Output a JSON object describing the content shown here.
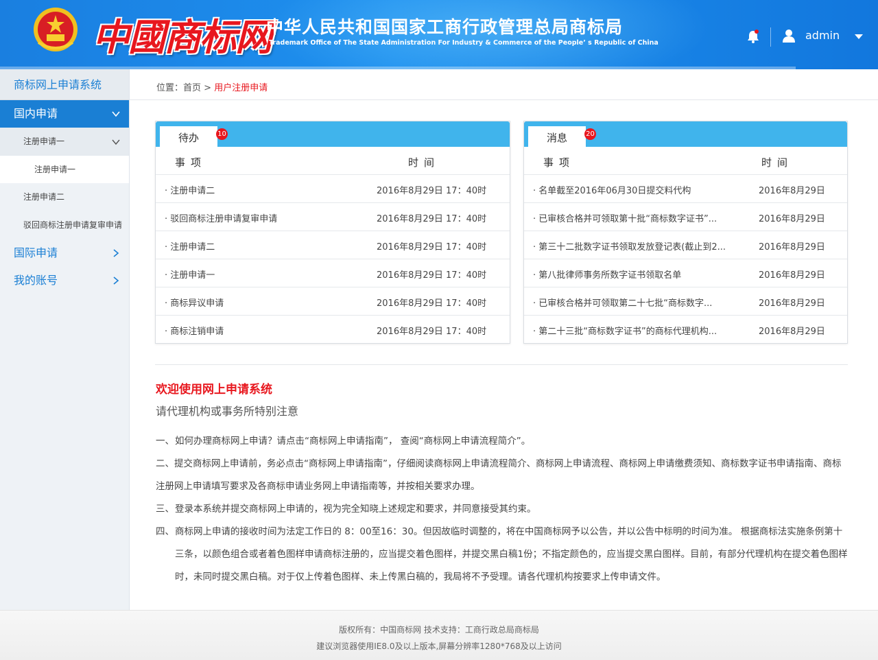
{
  "header": {
    "logo_text": "中國商标网",
    "org_title": "中华人民共和国国家工商行政管理总局商标局",
    "org_subtitle": "Trademark Office of The State Administration For Industry & Commerce of the People’ s Republic of China",
    "username": "admin"
  },
  "sidebar": {
    "title": "商标网上申请系统",
    "domestic": "国内申请",
    "reg1": "注册申请一",
    "reg1_sub": "注册申请一",
    "reg2": "注册申请二",
    "reject_review": "驳回商标注册申请复审申请",
    "intl": "国际申请",
    "account": "我的账号"
  },
  "breadcrumb": {
    "label": "位置：",
    "home": "首页",
    "sep": ">",
    "current": "用户注册申请"
  },
  "todo": {
    "tab": "待办",
    "badge": "10",
    "col_item": "事项",
    "col_time": "时间",
    "rows": [
      {
        "title": "· 注册申请二",
        "time": "2016年8月29日  17：40时"
      },
      {
        "title": "· 驳回商标注册申请复审申请",
        "time": "2016年8月29日  17：40时"
      },
      {
        "title": "· 注册申请二",
        "time": "2016年8月29日  17：40时"
      },
      {
        "title": "· 注册申请一",
        "time": "2016年8月29日  17：40时"
      },
      {
        "title": "· 商标异议申请",
        "time": "2016年8月29日  17：40时"
      },
      {
        "title": "· 商标注销申请",
        "time": "2016年8月29日  17：40时"
      }
    ]
  },
  "messages": {
    "tab": "消息",
    "badge": "20",
    "col_item": "事项",
    "col_time": "时间",
    "rows": [
      {
        "title": "· 名单截至2016年06月30日提交料代构",
        "time": "2016年8月29日"
      },
      {
        "title": "· 已审核合格并可领取第十批“商标数字证书”...",
        "time": "2016年8月29日"
      },
      {
        "title": "· 第三十二批数字证书领取发放登记表(截止到2...",
        "time": "2016年8月29日"
      },
      {
        "title": "· 第八批律师事务所数字证书领取名单",
        "time": "2016年8月29日"
      },
      {
        "title": "· 已审核合格并可领取第二十七批“商标数字...",
        "time": "2016年8月29日"
      },
      {
        "title": "· 第二十三批“商标数字证书”的商标代理机构...",
        "time": "2016年8月29日"
      }
    ]
  },
  "welcome": {
    "title": "欢迎使用网上申请系统",
    "subtitle": "请代理机构或事务所特别注意",
    "rules": [
      {
        "num": "一、",
        "text": "如何办理商标网上申请？请点击“商标网上申请指南”， 查阅“商标网上申请流程简介”。"
      },
      {
        "num": "二、",
        "text": "提交商标网上申请前，务必点击“商标网上申请指南”，仔细阅读商标网上申请流程简介、商标网上申请流程、商标网上申请缴费须知、商标数字证书申请指南、商标注册网上申请填写要求及各商标申请业务网上申请指南等，并按相关要求办理。"
      },
      {
        "num": "三、",
        "text": "登录本系统并提交商标网上申请的，视为完全知晓上述规定和要求，并同意接受其约束。"
      },
      {
        "num": "四、",
        "text": "商标网上申请的接收时间为法定工作日的 8：00至16：30。但因故临时调整的，将在中国商标网予以公告，并以公告中标明的时间为准。 根据商标法实施条例第十三条，以颜色组合或者着色图样申请商标注册的，应当提交着色图样，并提交黑白稿1份；不指定颜色的，应当提交黑白图样。目前，有部分代理机构在提交着色图样时，未同时提交黑白稿。对于仅上传着色图样、未上传黑白稿的，我局将不予受理。请各代理机构按要求上传申请文件。"
      }
    ]
  },
  "footer": {
    "line1": "版权所有：中国商标网  技术支持：工商行政总局商标局",
    "line2": "建议浏览器使用IE8.0及以上版本,屏幕分辨率1280*768及以上访问"
  },
  "colors": {
    "brand_blue": "#1a7fd4",
    "panel_head": "#40b4ec",
    "accent_red": "#e8171e"
  }
}
